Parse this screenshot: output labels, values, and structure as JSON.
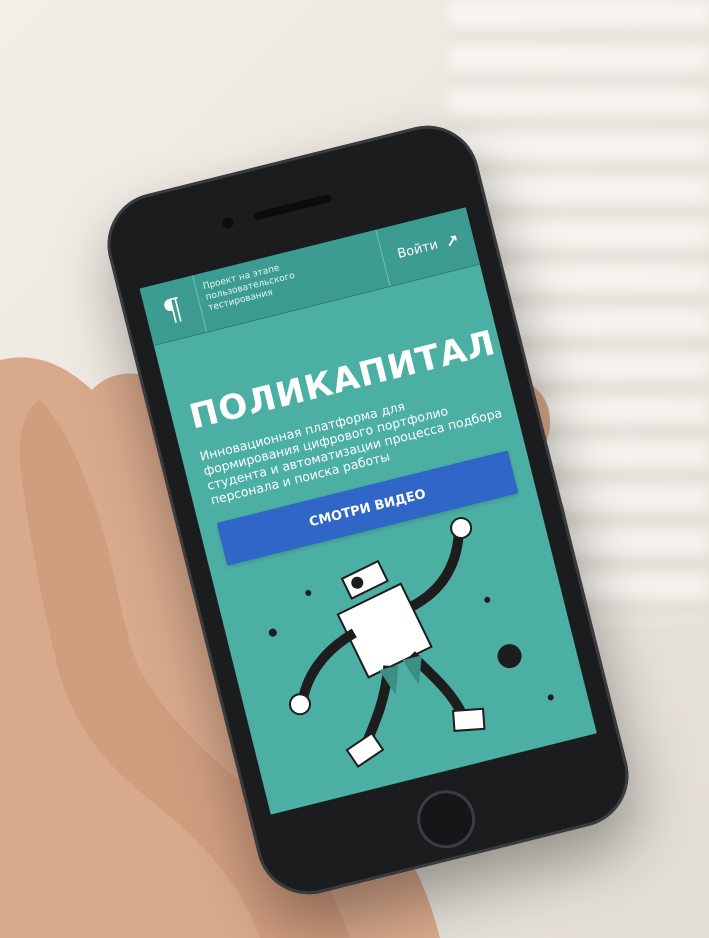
{
  "header": {
    "logo_glyph": "¶",
    "status_text": "Проект на этапе пользовательского тестирования",
    "login_label": "Войти",
    "login_arrow": "↗"
  },
  "hero": {
    "title": "ПОЛИКАПИТАЛ",
    "subtitle": "Инновационная платформа для формирования цифрового портфолио студента и автоматизации процесса подбора персонала и поиска работы",
    "video_button_label": "СМОТРИ ВИДЕО"
  },
  "colors": {
    "screen_bg": "#4bb0a3",
    "header_bg": "#3d9c92",
    "button_bg": "#2f66c8",
    "phone_body": "#1b1c1e"
  },
  "icons": [
    "robot-illustration",
    "arrow-up-right-icon",
    "logo-pilcrow-icon"
  ]
}
